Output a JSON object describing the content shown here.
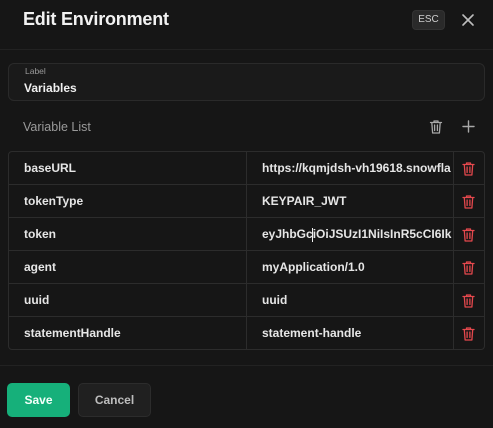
{
  "dialog": {
    "title": "Edit Environment",
    "esc_badge": "ESC"
  },
  "label_field": {
    "caption": "Label",
    "value": "Variables"
  },
  "variable_list": {
    "title": "Variable List",
    "rows": [
      {
        "key": "baseURL",
        "value": "https://kqmjdsh-vh19618.snowfla"
      },
      {
        "key": "tokenType",
        "value": "KEYPAIR_JWT"
      },
      {
        "key": "token",
        "value": "eyJhbGciOiJSUzI1NiIsInR5cCI6Ikp"
      },
      {
        "key": "agent",
        "value": "myApplication/1.0"
      },
      {
        "key": "uuid",
        "value": "uuid"
      },
      {
        "key": "statementHandle",
        "value": "statement-handle"
      }
    ]
  },
  "footer": {
    "save_label": "Save",
    "cancel_label": "Cancel"
  },
  "colors": {
    "background": "#161616",
    "primary_green": "#16b07a",
    "delete_red": "#e5484d",
    "muted_text": "#9a9a9a"
  },
  "icons": {
    "close": "close-icon",
    "trash": "trash-icon",
    "add": "plus-icon"
  }
}
